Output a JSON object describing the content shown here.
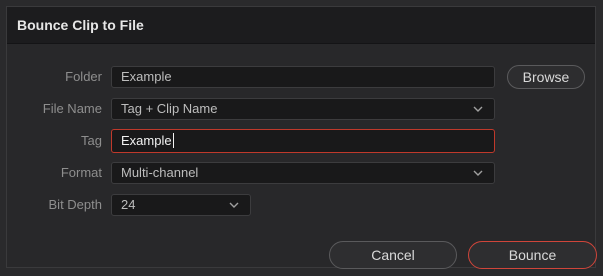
{
  "dialog": {
    "title": "Bounce Clip to File"
  },
  "form": {
    "folder": {
      "label": "Folder",
      "value": "Example"
    },
    "file_name": {
      "label": "File Name",
      "value": "Tag + Clip Name"
    },
    "tag": {
      "label": "Tag",
      "value": "Example"
    },
    "format": {
      "label": "Format",
      "value": "Multi-channel"
    },
    "bit_depth": {
      "label": "Bit Depth",
      "value": "24"
    }
  },
  "buttons": {
    "browse": "Browse",
    "cancel": "Cancel",
    "bounce": "Bounce"
  },
  "colors": {
    "accent": "#d0453a",
    "background": "#28282a",
    "titlebar": "#1c1c1e"
  },
  "icons": {
    "dropdown": "chevron-down-icon"
  }
}
